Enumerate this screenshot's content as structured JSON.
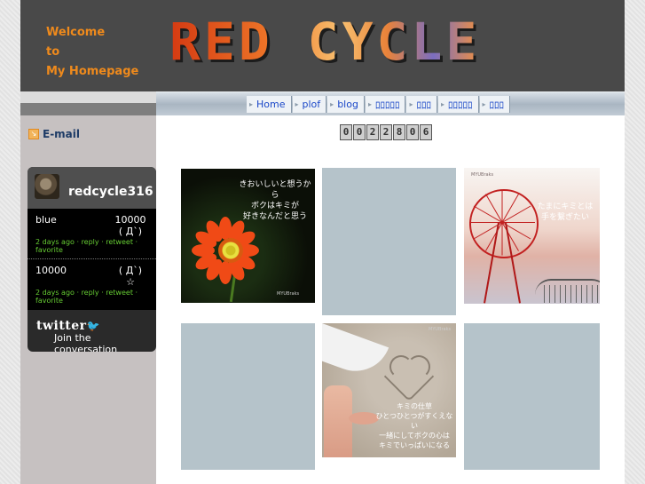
{
  "sidebar": {
    "welcome_lines": [
      "Welcome",
      "to",
      "My Homepage"
    ],
    "email_label": "E-mail",
    "email_icon": "mail-arrow-icon"
  },
  "twitter": {
    "username": "redcycle316",
    "tweets": [
      {
        "text": "blue",
        "value": "10000",
        "emote": "( Д`)",
        "meta": "2 days ago · reply · retweet · favorite"
      },
      {
        "text": "10000",
        "value": "( Д`)",
        "emote": "☆",
        "meta": "2 days ago · reply · retweet · favorite"
      }
    ],
    "logo": "twitter",
    "join": "Join the conversation"
  },
  "header": {
    "logo_text": "RED CYCLE"
  },
  "nav": {
    "items": [
      "Home",
      "plof",
      "blog",
      "ﾛﾛﾛﾛﾛ",
      "ﾛﾛﾛ",
      "ﾛﾛﾛﾛﾛ",
      "ﾛﾛﾛ"
    ]
  },
  "counter": {
    "digits": [
      "0",
      "0",
      "2",
      "2",
      "8",
      "0",
      "6"
    ]
  },
  "gallery": {
    "flower_caption": "きおいしいと想うから\nボクはキミが\n好きなんだと思う",
    "flower_sig": "MYUBraks",
    "ferris_caption": "たまにキミとは\n手を繋ぎたい",
    "ferris_sig": "MYUBraks",
    "sand_caption": "キミの仕草\nひとつひとつがすくえない\n一緒にしてボクの心は\nキミでいっぱいになる",
    "sand_sig": "MYUBraks"
  },
  "colors": {
    "sidebar_bg": "#c6c1c1",
    "header_bg": "#494949",
    "welcome_orange": "#ef8a1c",
    "nav_link": "#1a47c8",
    "placeholder": "#b5c3ca",
    "twitter_meta": "#66cc33"
  }
}
